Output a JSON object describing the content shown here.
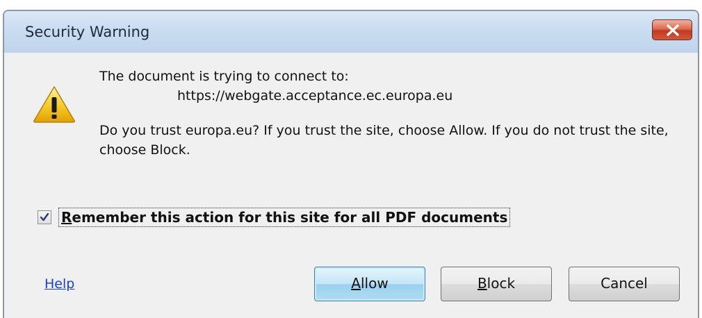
{
  "dialog": {
    "title": "Security Warning",
    "close_icon": "close-icon"
  },
  "message": {
    "warning_icon": "warning-triangle-icon",
    "connect_line": "The document is trying to connect to:",
    "url": "https://webgate.acceptance.ec.europa.eu",
    "question": "Do you trust europa.eu? If you trust the site, choose Allow. If you do not trust the site, choose Block."
  },
  "remember": {
    "checked": true,
    "label_accel": "R",
    "label_rest": "emember this action for this site for all PDF documents"
  },
  "footer": {
    "help_label": "Help",
    "allow_accel": "A",
    "allow_rest": "llow",
    "block_accel": "B",
    "block_rest": "lock",
    "cancel_label": "Cancel"
  },
  "colors": {
    "titlebar": "#c9dcf1",
    "close_button": "#c23a20",
    "link": "#1a3fd0",
    "default_button_border": "#3c7fb1"
  }
}
